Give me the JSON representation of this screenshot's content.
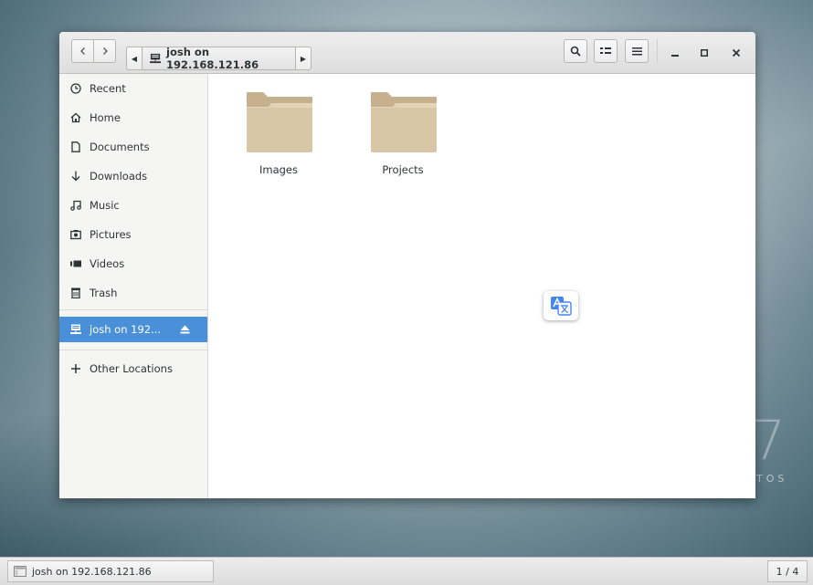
{
  "window": {
    "path_crumb": "josh on 192.168.121.86",
    "buttons": {
      "back": "back-icon",
      "forward": "forward-icon",
      "search": "search-icon",
      "view_options": "list-view-icon",
      "menu": "hamburger-menu-icon",
      "minimize": "minimize-icon",
      "maximize": "maximize-icon",
      "close": "close-icon"
    }
  },
  "sidebar": {
    "items": [
      {
        "label": "Recent",
        "icon": "clock-icon"
      },
      {
        "label": "Home",
        "icon": "home-icon"
      },
      {
        "label": "Documents",
        "icon": "document-icon"
      },
      {
        "label": "Downloads",
        "icon": "download-icon"
      },
      {
        "label": "Music",
        "icon": "music-icon"
      },
      {
        "label": "Pictures",
        "icon": "camera-icon"
      },
      {
        "label": "Videos",
        "icon": "video-icon"
      },
      {
        "label": "Trash",
        "icon": "trash-icon"
      }
    ],
    "network_item": {
      "label": "josh on 192...",
      "icon": "network-drive-icon",
      "active": true
    },
    "other_locations": {
      "label": "Other Locations",
      "icon": "plus-icon"
    }
  },
  "files": [
    {
      "name": "Images",
      "icon": "folder-icon"
    },
    {
      "name": "Projects",
      "icon": "folder-icon"
    }
  ],
  "overlay": {
    "icon": "translate-icon"
  },
  "taskbar": {
    "task_label": "josh on 192.168.121.86",
    "workspace": "1 / 4"
  },
  "colors": {
    "accent": "#4a90d9",
    "folder": "#d8c6a6",
    "folder_dark": "#c6b08e"
  }
}
